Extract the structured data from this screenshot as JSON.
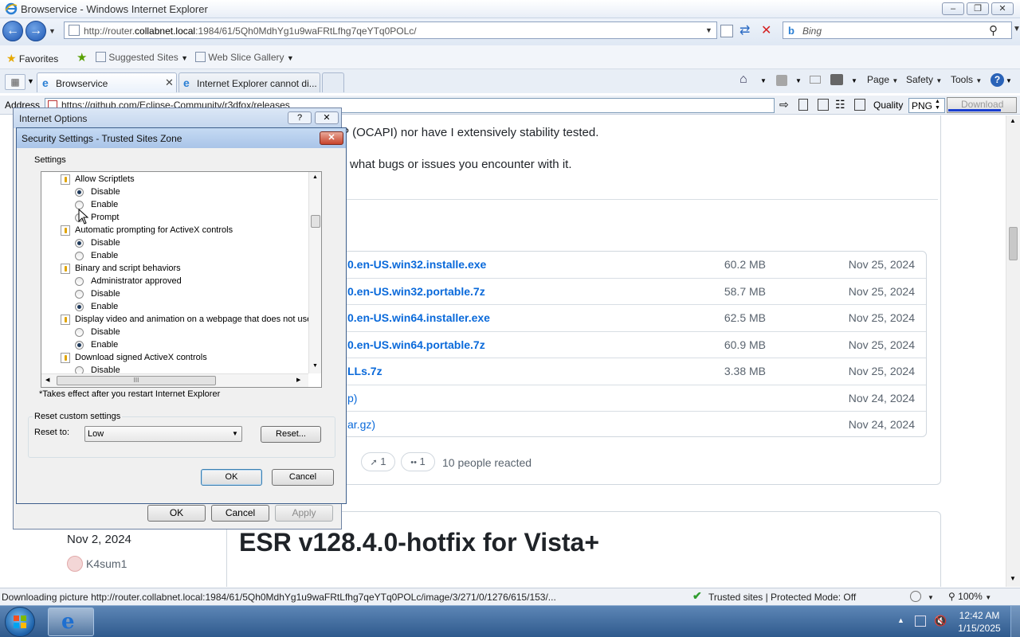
{
  "window": {
    "title": "Browservice - Windows Internet Explorer"
  },
  "nav": {
    "url_prefix": "http://router.",
    "url_host": "collabnet.local",
    "url_rest": ":1984/61/5Qh0MdhYg1u9waFRtLfhg7qeYTq0POLc/",
    "search_placeholder": "Bing"
  },
  "favorites": {
    "label": "Favorites",
    "suggested": "Suggested Sites",
    "gallery": "Web Slice Gallery"
  },
  "tabs": [
    {
      "label": "Browservice"
    },
    {
      "label": "Internet Explorer cannot di..."
    }
  ],
  "commandbar": {
    "page": "Page",
    "safety": "Safety",
    "tools": "Tools"
  },
  "toolbar": {
    "address_label": "Address",
    "address_value": "https://github.com/Eclipse-Community/r3dfox/releases",
    "quality_label": "Quality",
    "quality_value": "PNG",
    "download_label": "Download"
  },
  "page": {
    "text1": "IP (OCAPI) nor have I extensively stability tested.",
    "text2": "w what bugs or issues you encounter with it.",
    "assets": [
      {
        "name": "0.en-US.win32.installe.exe",
        "size": "60.2 MB",
        "date": "Nov 25, 2024"
      },
      {
        "name": "0.en-US.win32.portable.7z",
        "size": "58.7 MB",
        "date": "Nov 25, 2024"
      },
      {
        "name": "0.en-US.win64.installer.exe",
        "size": "62.5 MB",
        "date": "Nov 25, 2024"
      },
      {
        "name": "0.en-US.win64.portable.7z",
        "size": "60.9 MB",
        "date": "Nov 25, 2024"
      },
      {
        "name": "LLs.7z",
        "size": "3.38 MB",
        "date": "Nov 25, 2024"
      },
      {
        "name": "p)",
        "size": "",
        "date": "Nov 24, 2024"
      },
      {
        "name": "ar.gz)",
        "size": "",
        "date": "Nov 24, 2024"
      }
    ],
    "reaction_rocket": "1",
    "reaction_eyes": "1",
    "reacted_text": "10 people reacted",
    "side_date": "Nov 2, 2024",
    "side_author": "K4sum1",
    "release_title": "ESR v128.4.0-hotfix for Vista+"
  },
  "statusbar": {
    "text": "Downloading picture http://router.collabnet.local:1984/61/5Qh0MdhYg1u9waFRtLfhg7qeYTq0POLc/image/3/271/0/1276/615/153/...",
    "zone": "Trusted sites | Protected Mode: Off",
    "zoom": "100%"
  },
  "internet_options": {
    "title": "Internet Options",
    "ok": "OK",
    "cancel": "Cancel",
    "apply": "Apply"
  },
  "security_dialog": {
    "title": "Security Settings - Trusted Sites Zone",
    "settings_label": "Settings",
    "tree": [
      {
        "type": "group",
        "label": "Allow Scriptlets"
      },
      {
        "type": "option",
        "label": "Disable",
        "checked": true
      },
      {
        "type": "option",
        "label": "Enable",
        "checked": false
      },
      {
        "type": "option",
        "label": "Prompt",
        "checked": false
      },
      {
        "type": "group",
        "label": "Automatic prompting for ActiveX controls"
      },
      {
        "type": "option",
        "label": "Disable",
        "checked": true
      },
      {
        "type": "option",
        "label": "Enable",
        "checked": false
      },
      {
        "type": "group",
        "label": "Binary and script behaviors"
      },
      {
        "type": "option",
        "label": "Administrator approved",
        "checked": false
      },
      {
        "type": "option",
        "label": "Disable",
        "checked": false
      },
      {
        "type": "option",
        "label": "Enable",
        "checked": true
      },
      {
        "type": "group",
        "label": "Display video and animation on a webpage that does not use"
      },
      {
        "type": "option",
        "label": "Disable",
        "checked": false
      },
      {
        "type": "option",
        "label": "Enable",
        "checked": true
      },
      {
        "type": "group",
        "label": "Download signed ActiveX controls"
      },
      {
        "type": "option",
        "label": "Disable",
        "checked": false
      }
    ],
    "note": "*Takes effect after you restart Internet Explorer",
    "reset_group": "Reset custom settings",
    "reset_to_label": "Reset to:",
    "reset_to_value": "Low",
    "reset_button": "Reset...",
    "ok": "OK",
    "cancel": "Cancel"
  },
  "taskbar": {
    "time": "12:42 AM",
    "date": "1/15/2025"
  }
}
